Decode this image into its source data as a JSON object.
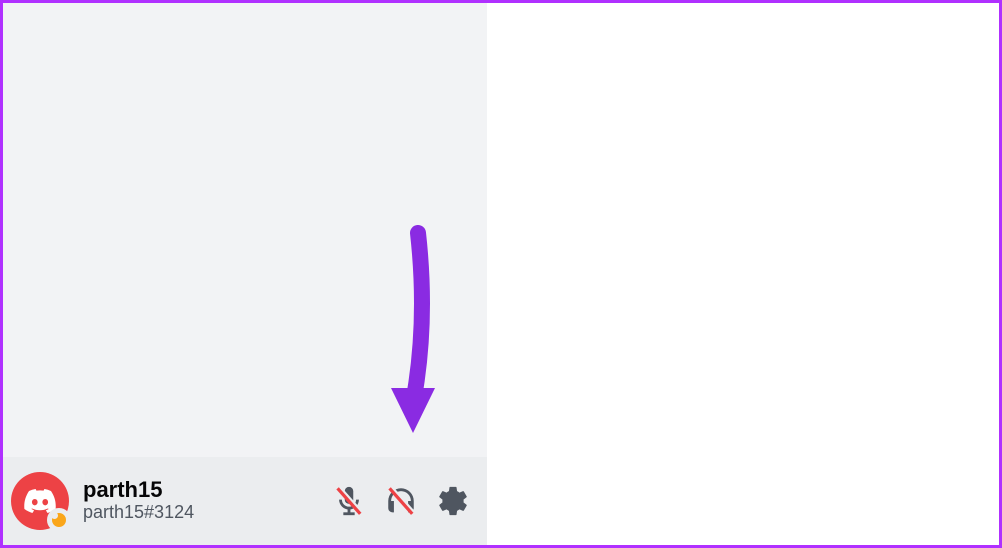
{
  "user": {
    "name": "parth15",
    "tag": "parth15#3124",
    "status": "idle"
  },
  "colors": {
    "avatar_bg": "#ed4245",
    "status_idle": "#faa61a",
    "border": "#b030ff",
    "arrow": "#8a2be2"
  },
  "icons": {
    "mic": "mute-mic-icon",
    "headphones": "deafen-headphones-icon",
    "settings": "gear-icon",
    "avatar": "discord-logo-icon"
  }
}
